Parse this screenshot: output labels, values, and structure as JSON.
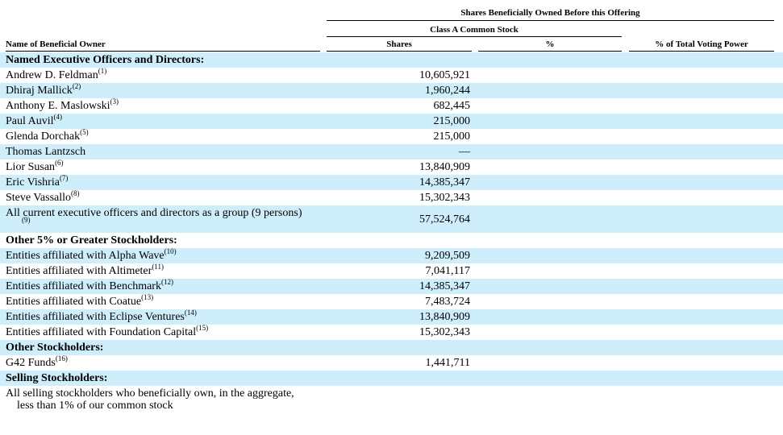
{
  "header": {
    "group_title": "Shares Beneficially Owned Before this Offering",
    "class_title": "Class A Common Stock",
    "col_name": "Name of Beneficial Owner",
    "col_shares": "Shares",
    "col_pct": "%",
    "col_voting": "% of Total Voting Power"
  },
  "sections": {
    "named": "Named Executive Officers and Directors:",
    "other5": "Other 5% or Greater Stockholders:",
    "other": "Other Stockholders:",
    "selling": "Selling Stockholders:"
  },
  "named_rows": [
    {
      "name": "Andrew D. Feldman",
      "fn": "(1)",
      "shares": "10,605,921"
    },
    {
      "name": "Dhiraj Mallick",
      "fn": "(2)",
      "shares": "1,960,244"
    },
    {
      "name": "Anthony E. Maslowski",
      "fn": "(3)",
      "shares": "682,445"
    },
    {
      "name": "Paul Auvil",
      "fn": "(4)",
      "shares": "215,000"
    },
    {
      "name": "Glenda Dorchak",
      "fn": "(5)",
      "shares": "215,000"
    },
    {
      "name": "Thomas Lantzsch",
      "fn": "",
      "shares": "—"
    },
    {
      "name": "Lior Susan",
      "fn": "(6)",
      "shares": "13,840,909"
    },
    {
      "name": "Eric Vishria",
      "fn": "(7)",
      "shares": "14,385,347"
    },
    {
      "name": "Steve Vassallo",
      "fn": "(8)",
      "shares": "15,302,343"
    }
  ],
  "group_row": {
    "name": "All current executive officers and directors as a group (9 persons)",
    "fn": "(9)",
    "shares": "57,524,764"
  },
  "other5_rows": [
    {
      "name": "Entities affiliated with Alpha Wave",
      "fn": "(10)",
      "shares": "9,209,509"
    },
    {
      "name": "Entities affiliated with Altimeter",
      "fn": "(11)",
      "shares": "7,041,117"
    },
    {
      "name": "Entities affiliated with Benchmark",
      "fn": "(12)",
      "shares": "14,385,347"
    },
    {
      "name": "Entities affiliated with Coatue",
      "fn": "(13)",
      "shares": "7,483,724"
    },
    {
      "name": "Entities affiliated with Eclipse Ventures",
      "fn": "(14)",
      "shares": "13,840,909"
    },
    {
      "name": "Entities affiliated with Foundation Capital",
      "fn": "(15)",
      "shares": "15,302,343"
    }
  ],
  "other_rows": [
    {
      "name": "G42 Funds",
      "fn": "(16)",
      "shares": "1,441,711"
    }
  ],
  "selling_row": {
    "line1": "All selling stockholders who beneficially own, in the aggregate,",
    "line2": "less than 1% of our common stock"
  },
  "colors": {
    "shade": "#cfeefb"
  }
}
